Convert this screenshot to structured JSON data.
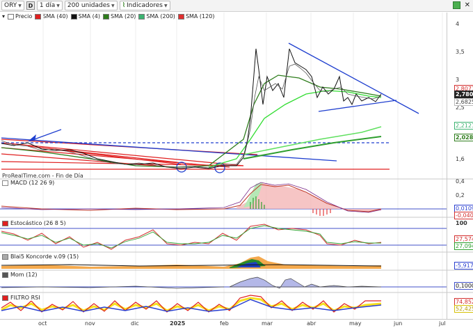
{
  "toolbar": {
    "ticker": "ORY",
    "mode_badge": "D",
    "period": "1 día",
    "units": "200 unidades",
    "indicators": "Indicadores"
  },
  "legend": [
    {
      "label": "Precio",
      "color": "#ffffff"
    },
    {
      "label": "SMA (40)",
      "color": "#e02020"
    },
    {
      "label": "SMA (4)",
      "color": "#111111"
    },
    {
      "label": "SMA (20)",
      "color": "#2e7d1c"
    },
    {
      "label": "SMA (200)",
      "color": "#3cb371"
    },
    {
      "label": "SMA (120)",
      "color": "#e03030"
    }
  ],
  "source_text": "ProRealTime.com - Fin de Día",
  "price_axis": {
    "ticks": [
      "4",
      "3,5",
      "3",
      "2,5",
      "1,6"
    ],
    "tags": [
      {
        "text": "2,8077",
        "color": "#d32f2f"
      },
      {
        "text": "2,780",
        "color": "#222222"
      },
      {
        "text": "2,6825",
        "color": "#444444"
      },
      {
        "text": "2,2121",
        "color": "#3cb371"
      },
      {
        "text": "2,028",
        "color": "#2e7d1c"
      }
    ]
  },
  "panes": {
    "macd": {
      "title": "MACD (12 26 9)",
      "ticks": [
        "0,4",
        "0,2"
      ],
      "tags": [
        "0,0109",
        "-0,0400"
      ]
    },
    "stoch": {
      "title": "Estocástico (26 8 5)",
      "ticks": [
        "100"
      ],
      "tags": [
        "27,574",
        "27,094"
      ]
    },
    "koncorde": {
      "title": "Blai5 Koncorde v.09 (15)",
      "tags": [
        "-5,9179"
      ]
    },
    "mom": {
      "title": "Mom (12)",
      "tags": [
        "0,1000"
      ]
    },
    "rsi": {
      "title": "FILTRO RSI",
      "tags": [
        "74,852",
        "52,425"
      ]
    }
  },
  "chart_data": {
    "type": "line",
    "x_labels": [
      "oct",
      "nov",
      "dic",
      "2025",
      "feb",
      "mar",
      "abr",
      "may",
      "jun",
      "jul"
    ],
    "price_approx": [
      {
        "date": "2024-09",
        "close": 1.85
      },
      {
        "date": "2024-10",
        "close": 1.8
      },
      {
        "date": "2024-11",
        "close": 1.72
      },
      {
        "date": "2024-12",
        "close": 1.66
      },
      {
        "date": "2025-01",
        "close": 1.62
      },
      {
        "date": "2025-02",
        "close": 1.72
      },
      {
        "date": "2025-03",
        "close": 3.4
      },
      {
        "date": "2025-04",
        "close": 2.8
      },
      {
        "date": "2025-05",
        "close": 2.78
      }
    ],
    "last_price": 2.78
  }
}
